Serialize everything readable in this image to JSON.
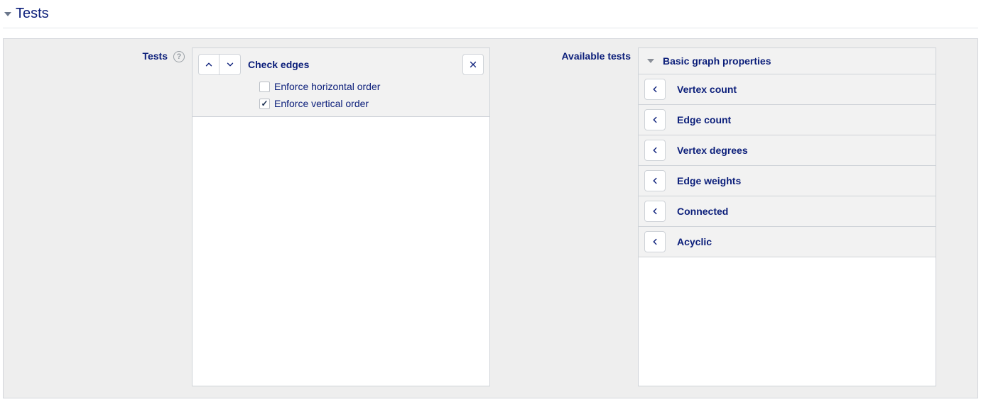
{
  "section": {
    "title": "Tests"
  },
  "left": {
    "label": "Tests",
    "selected": {
      "title": "Check edges",
      "options": [
        {
          "label": "Enforce horizontal order",
          "checked": false
        },
        {
          "label": "Enforce vertical order",
          "checked": true
        }
      ]
    }
  },
  "right": {
    "label": "Available tests",
    "group": {
      "title": "Basic graph properties"
    },
    "items": [
      {
        "label": "Vertex count"
      },
      {
        "label": "Edge count"
      },
      {
        "label": "Vertex degrees"
      },
      {
        "label": "Edge weights"
      },
      {
        "label": "Connected"
      },
      {
        "label": "Acyclic"
      }
    ]
  }
}
